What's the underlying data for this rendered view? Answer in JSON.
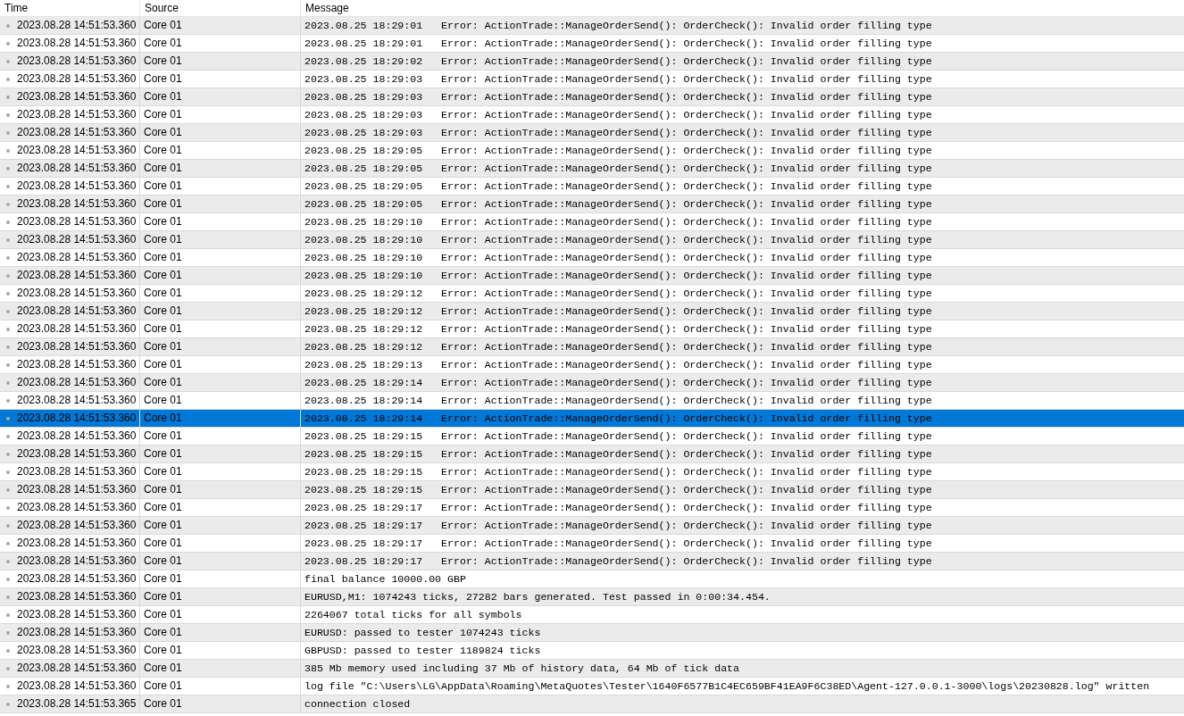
{
  "table": {
    "columns": [
      "Time",
      "Source",
      "Message"
    ],
    "rows": [
      {
        "time": "2023.08.28 14:51:53.360",
        "source": "Core 01",
        "message": "2023.08.25 18:29:01   Error: ActionTrade::ManageOrderSend(): OrderCheck(): Invalid order filling type",
        "selected": false
      },
      {
        "time": "2023.08.28 14:51:53.360",
        "source": "Core 01",
        "message": "2023.08.25 18:29:01   Error: ActionTrade::ManageOrderSend(): OrderCheck(): Invalid order filling type",
        "selected": false
      },
      {
        "time": "2023.08.28 14:51:53.360",
        "source": "Core 01",
        "message": "2023.08.25 18:29:02   Error: ActionTrade::ManageOrderSend(): OrderCheck(): Invalid order filling type",
        "selected": false
      },
      {
        "time": "2023.08.28 14:51:53.360",
        "source": "Core 01",
        "message": "2023.08.25 18:29:03   Error: ActionTrade::ManageOrderSend(): OrderCheck(): Invalid order filling type",
        "selected": false
      },
      {
        "time": "2023.08.28 14:51:53.360",
        "source": "Core 01",
        "message": "2023.08.25 18:29:03   Error: ActionTrade::ManageOrderSend(): OrderCheck(): Invalid order filling type",
        "selected": false
      },
      {
        "time": "2023.08.28 14:51:53.360",
        "source": "Core 01",
        "message": "2023.08.25 18:29:03   Error: ActionTrade::ManageOrderSend(): OrderCheck(): Invalid order filling type",
        "selected": false
      },
      {
        "time": "2023.08.28 14:51:53.360",
        "source": "Core 01",
        "message": "2023.08.25 18:29:03   Error: ActionTrade::ManageOrderSend(): OrderCheck(): Invalid order filling type",
        "selected": false
      },
      {
        "time": "2023.08.28 14:51:53.360",
        "source": "Core 01",
        "message": "2023.08.25 18:29:05   Error: ActionTrade::ManageOrderSend(): OrderCheck(): Invalid order filling type",
        "selected": false
      },
      {
        "time": "2023.08.28 14:51:53.360",
        "source": "Core 01",
        "message": "2023.08.25 18:29:05   Error: ActionTrade::ManageOrderSend(): OrderCheck(): Invalid order filling type",
        "selected": false
      },
      {
        "time": "2023.08.28 14:51:53.360",
        "source": "Core 01",
        "message": "2023.08.25 18:29:05   Error: ActionTrade::ManageOrderSend(): OrderCheck(): Invalid order filling type",
        "selected": false
      },
      {
        "time": "2023.08.28 14:51:53.360",
        "source": "Core 01",
        "message": "2023.08.25 18:29:05   Error: ActionTrade::ManageOrderSend(): OrderCheck(): Invalid order filling type",
        "selected": false
      },
      {
        "time": "2023.08.28 14:51:53.360",
        "source": "Core 01",
        "message": "2023.08.25 18:29:10   Error: ActionTrade::ManageOrderSend(): OrderCheck(): Invalid order filling type",
        "selected": false
      },
      {
        "time": "2023.08.28 14:51:53.360",
        "source": "Core 01",
        "message": "2023.08.25 18:29:10   Error: ActionTrade::ManageOrderSend(): OrderCheck(): Invalid order filling type",
        "selected": false
      },
      {
        "time": "2023.08.28 14:51:53.360",
        "source": "Core 01",
        "message": "2023.08.25 18:29:10   Error: ActionTrade::ManageOrderSend(): OrderCheck(): Invalid order filling type",
        "selected": false
      },
      {
        "time": "2023.08.28 14:51:53.360",
        "source": "Core 01",
        "message": "2023.08.25 18:29:10   Error: ActionTrade::ManageOrderSend(): OrderCheck(): Invalid order filling type",
        "selected": false
      },
      {
        "time": "2023.08.28 14:51:53.360",
        "source": "Core 01",
        "message": "2023.08.25 18:29:12   Error: ActionTrade::ManageOrderSend(): OrderCheck(): Invalid order filling type",
        "selected": false
      },
      {
        "time": "2023.08.28 14:51:53.360",
        "source": "Core 01",
        "message": "2023.08.25 18:29:12   Error: ActionTrade::ManageOrderSend(): OrderCheck(): Invalid order filling type",
        "selected": false
      },
      {
        "time": "2023.08.28 14:51:53.360",
        "source": "Core 01",
        "message": "2023.08.25 18:29:12   Error: ActionTrade::ManageOrderSend(): OrderCheck(): Invalid order filling type",
        "selected": false
      },
      {
        "time": "2023.08.28 14:51:53.360",
        "source": "Core 01",
        "message": "2023.08.25 18:29:12   Error: ActionTrade::ManageOrderSend(): OrderCheck(): Invalid order filling type",
        "selected": false
      },
      {
        "time": "2023.08.28 14:51:53.360",
        "source": "Core 01",
        "message": "2023.08.25 18:29:13   Error: ActionTrade::ManageOrderSend(): OrderCheck(): Invalid order filling type",
        "selected": false
      },
      {
        "time": "2023.08.28 14:51:53.360",
        "source": "Core 01",
        "message": "2023.08.25 18:29:14   Error: ActionTrade::ManageOrderSend(): OrderCheck(): Invalid order filling type",
        "selected": false
      },
      {
        "time": "2023.08.28 14:51:53.360",
        "source": "Core 01",
        "message": "2023.08.25 18:29:14   Error: ActionTrade::ManageOrderSend(): OrderCheck(): Invalid order filling type",
        "selected": false
      },
      {
        "time": "2023.08.28 14:51:53.360",
        "source": "Core 01",
        "message": "2023.08.25 18:29:14   Error: ActionTrade::ManageOrderSend(): OrderCheck(): Invalid order filling type",
        "selected": true
      },
      {
        "time": "2023.08.28 14:51:53.360",
        "source": "Core 01",
        "message": "2023.08.25 18:29:15   Error: ActionTrade::ManageOrderSend(): OrderCheck(): Invalid order filling type",
        "selected": false
      },
      {
        "time": "2023.08.28 14:51:53.360",
        "source": "Core 01",
        "message": "2023.08.25 18:29:15   Error: ActionTrade::ManageOrderSend(): OrderCheck(): Invalid order filling type",
        "selected": false
      },
      {
        "time": "2023.08.28 14:51:53.360",
        "source": "Core 01",
        "message": "2023.08.25 18:29:15   Error: ActionTrade::ManageOrderSend(): OrderCheck(): Invalid order filling type",
        "selected": false
      },
      {
        "time": "2023.08.28 14:51:53.360",
        "source": "Core 01",
        "message": "2023.08.25 18:29:15   Error: ActionTrade::ManageOrderSend(): OrderCheck(): Invalid order filling type",
        "selected": false
      },
      {
        "time": "2023.08.28 14:51:53.360",
        "source": "Core 01",
        "message": "2023.08.25 18:29:17   Error: ActionTrade::ManageOrderSend(): OrderCheck(): Invalid order filling type",
        "selected": false
      },
      {
        "time": "2023.08.28 14:51:53.360",
        "source": "Core 01",
        "message": "2023.08.25 18:29:17   Error: ActionTrade::ManageOrderSend(): OrderCheck(): Invalid order filling type",
        "selected": false
      },
      {
        "time": "2023.08.28 14:51:53.360",
        "source": "Core 01",
        "message": "2023.08.25 18:29:17   Error: ActionTrade::ManageOrderSend(): OrderCheck(): Invalid order filling type",
        "selected": false
      },
      {
        "time": "2023.08.28 14:51:53.360",
        "source": "Core 01",
        "message": "2023.08.25 18:29:17   Error: ActionTrade::ManageOrderSend(): OrderCheck(): Invalid order filling type",
        "selected": false
      },
      {
        "time": "2023.08.28 14:51:53.360",
        "source": "Core 01",
        "message": "final balance 10000.00 GBP",
        "selected": false
      },
      {
        "time": "2023.08.28 14:51:53.360",
        "source": "Core 01",
        "message": "EURUSD,M1: 1074243 ticks, 27282 bars generated. Test passed in 0:00:34.454.",
        "selected": false
      },
      {
        "time": "2023.08.28 14:51:53.360",
        "source": "Core 01",
        "message": "2264067 total ticks for all symbols",
        "selected": false
      },
      {
        "time": "2023.08.28 14:51:53.360",
        "source": "Core 01",
        "message": "EURUSD: passed to tester 1074243 ticks",
        "selected": false
      },
      {
        "time": "2023.08.28 14:51:53.360",
        "source": "Core 01",
        "message": "GBPUSD: passed to tester 1189824 ticks",
        "selected": false
      },
      {
        "time": "2023.08.28 14:51:53.360",
        "source": "Core 01",
        "message": "385 Mb memory used including 37 Mb of history data, 64 Mb of tick data",
        "selected": false
      },
      {
        "time": "2023.08.28 14:51:53.360",
        "source": "Core 01",
        "message": "log file \"C:\\Users\\LG\\AppData\\Roaming\\MetaQuotes\\Tester\\1640F6577B1C4EC659BF41EA9F6C38ED\\Agent-127.0.0.1-3000\\logs\\20230828.log\" written",
        "selected": false
      },
      {
        "time": "2023.08.28 14:51:53.365",
        "source": "Core 01",
        "message": "connection closed",
        "selected": false
      }
    ]
  }
}
